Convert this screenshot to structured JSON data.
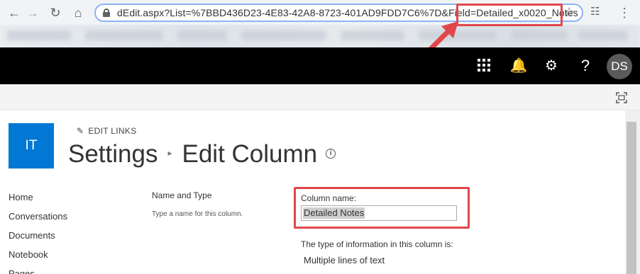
{
  "browser": {
    "url_display": "dEdit.aspx?List=%7BBD436D23-4E83-42A8-8723-401AD9FDD7C6%7D&Field=Detailed_x0020_Notes",
    "url_prefix": "dEdit.aspx?List=%7BBD436D23-4E83-42A8-8723-401AD9FDD7C6%7D&Field=",
    "url_highlight": "Detailed_x0020_Notes",
    "back_icon": "back-arrow-icon",
    "forward_icon": "forward-arrow-icon",
    "reload_icon": "reload-icon",
    "home_icon": "home-icon"
  },
  "suite_bar": {
    "avatar_initials": "DS",
    "help_label": "?"
  },
  "site": {
    "logo_text": "IT",
    "edit_links_label": "EDIT LINKS",
    "title_part1": "Settings",
    "title_part2": "Edit Column",
    "separator": "▸"
  },
  "left_nav": {
    "items": [
      "Home",
      "Conversations",
      "Documents",
      "Notebook",
      "Pages"
    ]
  },
  "form": {
    "section_title": "Name and Type",
    "section_description": "Type a name for this column.",
    "column_name_label": "Column name:",
    "column_name_value": "Detailed Notes",
    "type_label": "The type of information in this column is:",
    "type_value": "Multiple lines of text"
  },
  "colors": {
    "suite_bar": "#000000",
    "site_logo": "#0078d4",
    "annotation": "#e0474c"
  }
}
